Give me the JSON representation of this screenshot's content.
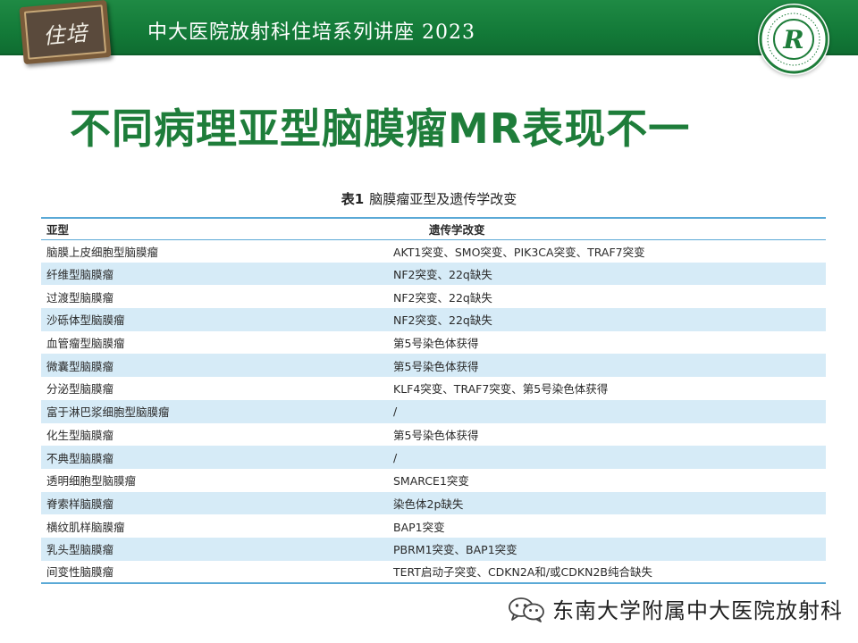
{
  "header": {
    "badge_text": "住培",
    "title": "中大医院放射科住培系列讲座 2023",
    "logo_letter": "R"
  },
  "slide_title": "不同病理亚型脑膜瘤MR表现不一",
  "table": {
    "caption_label": "表1",
    "caption_text": "脑膜瘤亚型及遗传学改变",
    "headers": [
      "亚型",
      "遗传学改变"
    ],
    "rows": [
      [
        "脑膜上皮细胞型脑膜瘤",
        "AKT1突变、SMO突变、PIK3CA突变、TRAF7突变"
      ],
      [
        "纤维型脑膜瘤",
        "NF2突变、22q缺失"
      ],
      [
        "过渡型脑膜瘤",
        "NF2突变、22q缺失"
      ],
      [
        "沙砾体型脑膜瘤",
        "NF2突变、22q缺失"
      ],
      [
        "血管瘤型脑膜瘤",
        "第5号染色体获得"
      ],
      [
        "微囊型脑膜瘤",
        "第5号染色体获得"
      ],
      [
        "分泌型脑膜瘤",
        "KLF4突变、TRAF7突变、第5号染色体获得"
      ],
      [
        "富于淋巴浆细胞型脑膜瘤",
        "/"
      ],
      [
        "化生型脑膜瘤",
        "第5号染色体获得"
      ],
      [
        "不典型脑膜瘤",
        "/"
      ],
      [
        "透明细胞型脑膜瘤",
        "SMARCE1突变"
      ],
      [
        "脊索样脑膜瘤",
        "染色体2p缺失"
      ],
      [
        "横纹肌样脑膜瘤",
        "BAP1突变"
      ],
      [
        "乳头型脑膜瘤",
        "PBRM1突变、BAP1突变"
      ],
      [
        "间变性脑膜瘤",
        "TERT启动子突变、CDKN2A和/或CDKN2B纯合缺失"
      ]
    ]
  },
  "footer": {
    "text": "东南大学附属中大医院放射科",
    "icon": "wechat-icon"
  },
  "colors": {
    "header_green": "#137a38",
    "title_green": "#1e7d3a",
    "table_rule": "#5aa9d6",
    "row_stripe": "#d6ebf7"
  }
}
